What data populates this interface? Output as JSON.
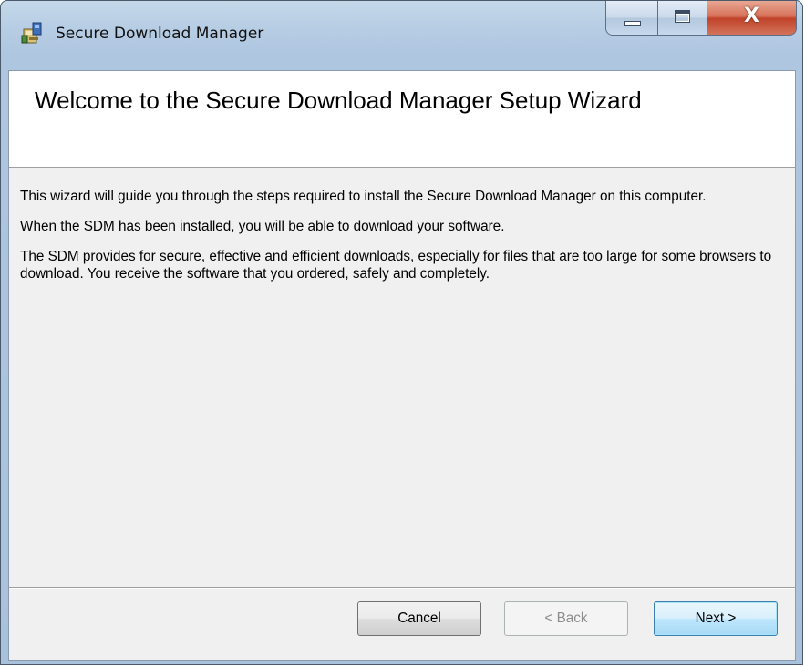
{
  "window": {
    "title": "Secure Download Manager",
    "app_icon": "installer-icon",
    "caption_buttons": {
      "minimize_icon": "minimize-icon",
      "maximize_icon": "maximize-icon",
      "close_glyph": "X",
      "close_icon": "close-icon"
    }
  },
  "banner": {
    "title": "Welcome to the Secure Download Manager Setup Wizard"
  },
  "body": {
    "paragraphs": [
      "This wizard will guide you through the steps required to install the Secure Download Manager on this computer.",
      "When the SDM has been installed, you will be able to download your software.",
      "The SDM provides for secure, effective and efficient downloads, especially for files that are too large for some browsers to download.  You receive the software that you ordered, safely and completely."
    ]
  },
  "buttons": {
    "cancel": "Cancel",
    "back": "< Back",
    "next": "Next >"
  },
  "colors": {
    "frame": "#aec6e0",
    "client": "#f0f0f0",
    "close_button": "#c0432a",
    "next_focus": "#3c7fb1"
  }
}
